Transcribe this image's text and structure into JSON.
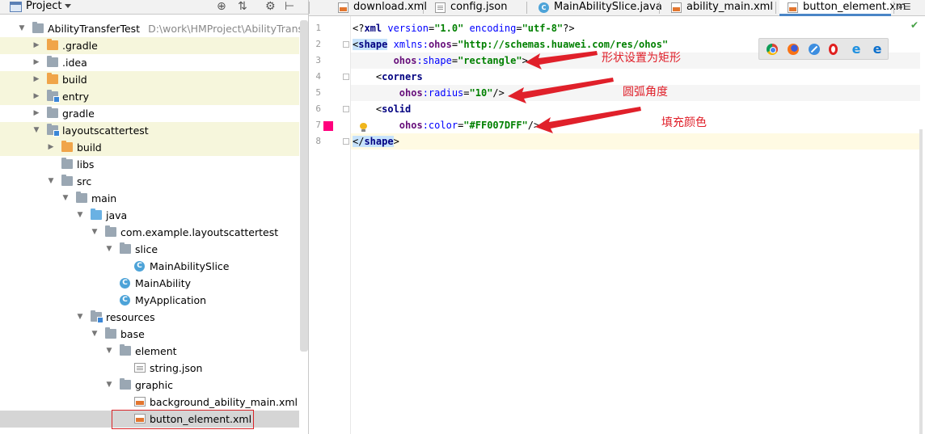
{
  "project_panel": {
    "title": "Project",
    "tree": [
      {
        "label": "AbilityTransferTest",
        "path": "D:\\work\\HMProject\\AbilityTransferTest",
        "icon": "folder-gray",
        "indent": 0,
        "expanded": true
      },
      {
        "label": ".gradle",
        "icon": "folder-orange",
        "indent": 1,
        "expanded": false
      },
      {
        "label": ".idea",
        "icon": "folder-gray",
        "indent": 1,
        "expanded": false
      },
      {
        "label": "build",
        "icon": "folder-orange",
        "indent": 1,
        "expanded": false
      },
      {
        "label": "entry",
        "icon": "folder-gray-module",
        "indent": 1,
        "expanded": false
      },
      {
        "label": "gradle",
        "icon": "folder-gray",
        "indent": 1,
        "expanded": false
      },
      {
        "label": "layoutscattertest",
        "icon": "folder-gray-module",
        "indent": 1,
        "expanded": true
      },
      {
        "label": "build",
        "icon": "folder-orange",
        "indent": 2,
        "expanded": false
      },
      {
        "label": "libs",
        "icon": "folder-gray",
        "indent": 2,
        "leaf": true
      },
      {
        "label": "src",
        "icon": "folder-gray",
        "indent": 2,
        "expanded": true
      },
      {
        "label": "main",
        "icon": "folder-gray",
        "indent": 3,
        "expanded": true
      },
      {
        "label": "java",
        "icon": "folder-blue",
        "indent": 4,
        "expanded": true
      },
      {
        "label": "com.example.layoutscattertest",
        "icon": "folder-gray",
        "indent": 5,
        "expanded": true
      },
      {
        "label": "slice",
        "icon": "folder-gray",
        "indent": 6,
        "expanded": true
      },
      {
        "label": "MainAbilitySlice",
        "icon": "class-icon",
        "indent": 7,
        "leaf": true
      },
      {
        "label": "MainAbility",
        "icon": "class-icon",
        "indent": 6,
        "leaf": true
      },
      {
        "label": "MyApplication",
        "icon": "class-icon",
        "indent": 6,
        "leaf": true
      },
      {
        "label": "resources",
        "icon": "folder-gray-res",
        "indent": 4,
        "expanded": true
      },
      {
        "label": "base",
        "icon": "folder-gray",
        "indent": 5,
        "expanded": true
      },
      {
        "label": "element",
        "icon": "folder-gray",
        "indent": 6,
        "expanded": true
      },
      {
        "label": "string.json",
        "icon": "json-file-icon",
        "indent": 7,
        "leaf": true
      },
      {
        "label": "graphic",
        "icon": "folder-gray",
        "indent": 6,
        "expanded": true
      },
      {
        "label": "background_ability_main.xml",
        "icon": "xml-file-icon",
        "indent": 7,
        "leaf": true
      },
      {
        "label": "button_element.xml",
        "icon": "xml-file-icon",
        "indent": 7,
        "leaf": true,
        "selected": true
      }
    ]
  },
  "tabs": [
    {
      "label": "download.xml",
      "icon": "xml-file-icon",
      "active": false
    },
    {
      "label": "config.json",
      "icon": "json-file-icon",
      "active": false
    },
    {
      "label": "MainAbilitySlice.java",
      "icon": "class-icon",
      "active": false
    },
    {
      "label": "ability_main.xml",
      "icon": "xml-file-icon",
      "active": false
    },
    {
      "label": "button_element.xm",
      "icon": "xml-file-icon",
      "active": true
    }
  ],
  "tab_overflow": "»☰",
  "editor": {
    "line_numbers": [
      "1",
      "2",
      "3",
      "4",
      "5",
      "6",
      "7",
      "8"
    ],
    "lines": [
      "<?xml version=\"1.0\" encoding=\"utf-8\"?>",
      "<shape xmlns:ohos=\"http://schemas.huawei.com/res/ohos\"",
      "       ohos:shape=\"rectangle\">",
      "    <corners",
      "        ohos:radius=\"10\"/>",
      "    <solid",
      "        ohos:color=\"#FF007DFF\"/>",
      "</shape>"
    ],
    "swatch_color": "#FF007D"
  },
  "annotations": [
    {
      "text": "形状设置为矩形"
    },
    {
      "text": "圆弧角度"
    },
    {
      "text": "填充颜色"
    }
  ],
  "browser_icons": [
    "chrome-icon",
    "firefox-icon",
    "safari-icon",
    "opera-icon",
    "ie-icon",
    "edge-icon"
  ],
  "colors": {
    "annotation_red": "#E0202A",
    "active_tab_underline": "#4A86C7",
    "selection_border": "#D9262A"
  }
}
